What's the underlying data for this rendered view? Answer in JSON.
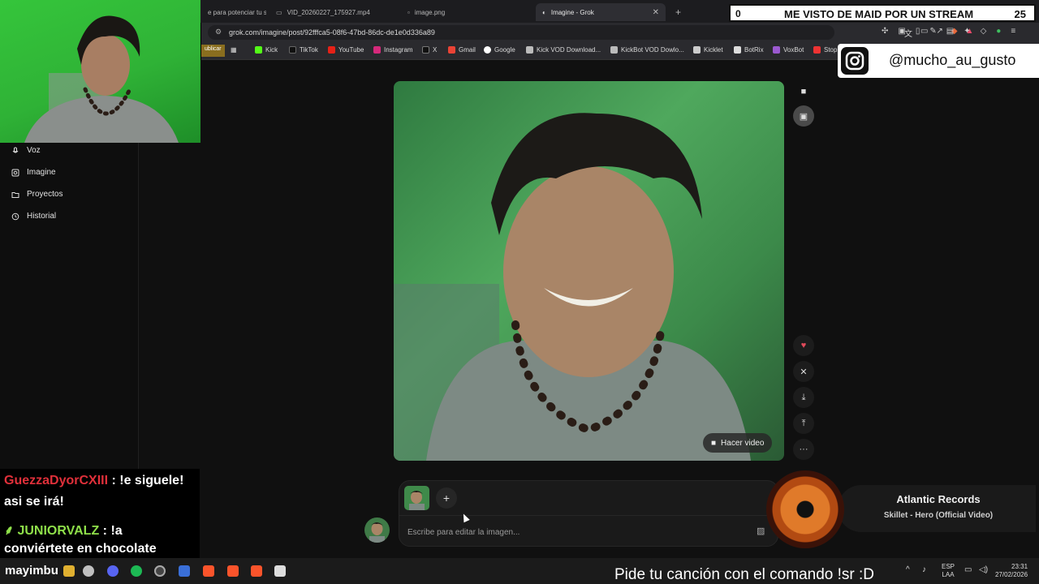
{
  "browser": {
    "tabs": [
      {
        "label": "e para potenciar tu s"
      },
      {
        "label": "VID_20260227_175927.mp4"
      },
      {
        "label": "image.png"
      },
      {
        "label": "Imagine - Grok"
      }
    ],
    "url": "grok.com/imagine/post/92fffca5-08f6-47bd-86dc-de1e0d336a89",
    "bookmarks": [
      "ublicar",
      "Kick",
      "TikTok",
      "YouTube",
      "Instagram",
      "X",
      "Gmail",
      "Google",
      "Kick VOD Download...",
      "KickBot VOD Dowlo...",
      "Kicklet",
      "BotRix",
      "VoxBot",
      "Stop"
    ]
  },
  "sidebar": {
    "items": [
      {
        "label": "Voz",
        "icon": "microphone-icon"
      },
      {
        "label": "Imagine",
        "icon": "image-icon"
      },
      {
        "label": "Proyectos",
        "icon": "folder-icon"
      },
      {
        "label": "Historial",
        "icon": "history-icon"
      }
    ]
  },
  "main": {
    "hacer_video": "Hacer video",
    "prompt_placeholder": "Escribe para editar la imagen...",
    "add_label": "+"
  },
  "overlay": {
    "counter_left": "0",
    "counter_title": "ME VISTO DE MAID POR UN STREAM",
    "counter_right": "25",
    "instagram_handle": "@mucho_au_gusto",
    "chat": [
      {
        "user": "GuezzaDyorCXIII",
        "line1": ": !e siguele!",
        "line2": "asi se irá!",
        "color": "#e0303a"
      },
      {
        "user": "JUNIORVALZ",
        "line1": ": !a",
        "line2": "conviértete en chocolate",
        "color": "#8fe04a"
      }
    ],
    "music_artist": "Atlantic Records",
    "music_title": "Skillet - Hero (Official Video)",
    "ticker": "Pide tu canción con el comando !sr :D",
    "taskbar_user": "mayimbu"
  },
  "tray": {
    "lang1": "ESP",
    "lang2": "LAA",
    "time": "23:31",
    "date": "27/02/2026"
  }
}
